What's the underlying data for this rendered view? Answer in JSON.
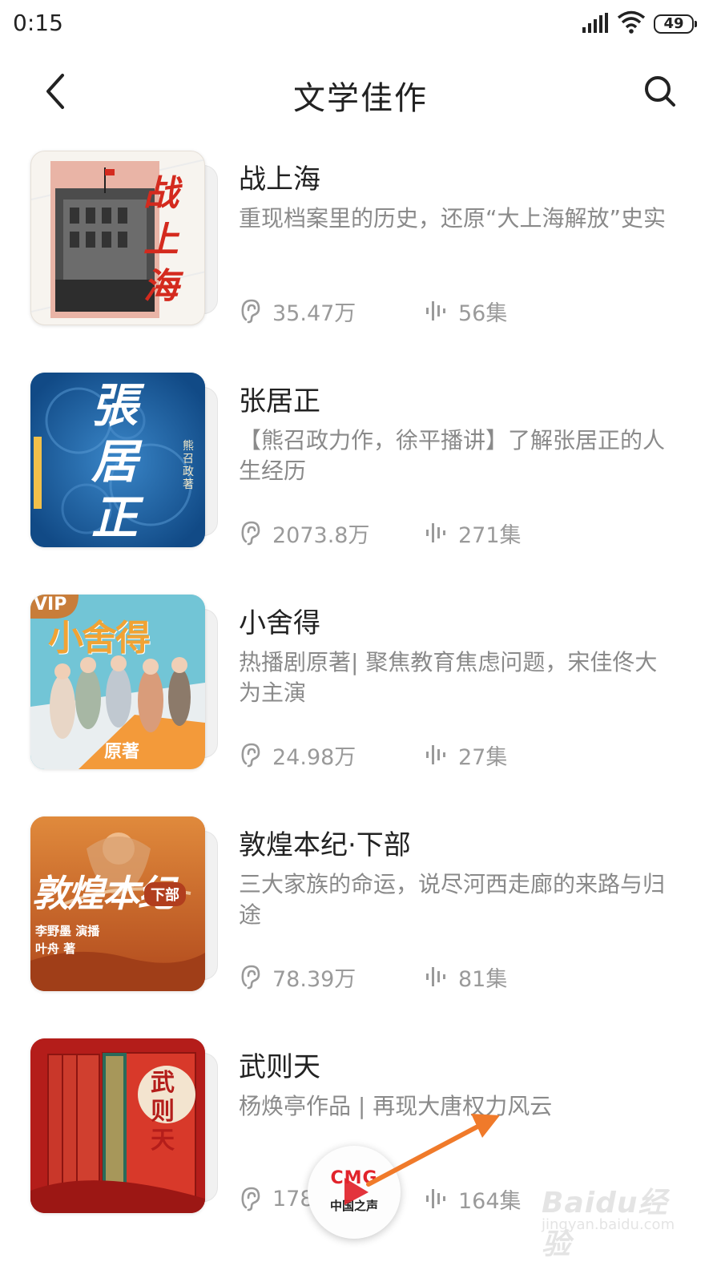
{
  "status_bar": {
    "time": "0:15",
    "battery": "49",
    "icons": [
      "signal-icon",
      "wifi-icon",
      "battery-icon"
    ]
  },
  "header": {
    "title": "文学佳作",
    "back_icon": "back-arrow-icon",
    "search_icon": "search-icon"
  },
  "books": [
    {
      "title": "战上海",
      "description": "重现档案里的历史，还原“大上海解放”史实",
      "plays": "35.47万",
      "episodes": "56集",
      "cover_text": "战上海"
    },
    {
      "title": "张居正",
      "description": "【熊召政力作，徐平播讲】了解张居正的人生经历",
      "plays": "2073.8万",
      "episodes": "271集",
      "cover_text": "張居正",
      "cover_author": "熊召政 著"
    },
    {
      "title": "小舍得",
      "description": "热播剧原著| 聚焦教育焦虑问题，宋佳佟大为主演",
      "plays": "24.98万",
      "episodes": "27集",
      "cover_badge": "VIP",
      "cover_text": "小舍得",
      "cover_tag": "原著"
    },
    {
      "title": "敦煌本纪·下部",
      "description": "三大家族的命运，说尽河西走廊的来路与归途",
      "plays": "78.39万",
      "episodes": "81集",
      "cover_text": "敦煌本纪",
      "cover_tag": "下部",
      "cover_credit_1": "李野墨 演播",
      "cover_credit_2": "叶舟 著"
    },
    {
      "title": "武则天",
      "description": "杨焕亭作品 | 再现大唐权力风云",
      "plays": "178",
      "episodes": "164集",
      "cover_text": "武则天"
    }
  ],
  "player": {
    "logo": "CMG",
    "name": "中国之声",
    "play_icon": "play-icon"
  },
  "watermark": {
    "main": "Baidu经验",
    "sub": "jingyan.baidu.com"
  },
  "colors": {
    "title_text": "#222222",
    "secondary_text": "#8a8a8a",
    "annotation_arrow": "#f07a2a",
    "player_red": "#e1232b"
  }
}
